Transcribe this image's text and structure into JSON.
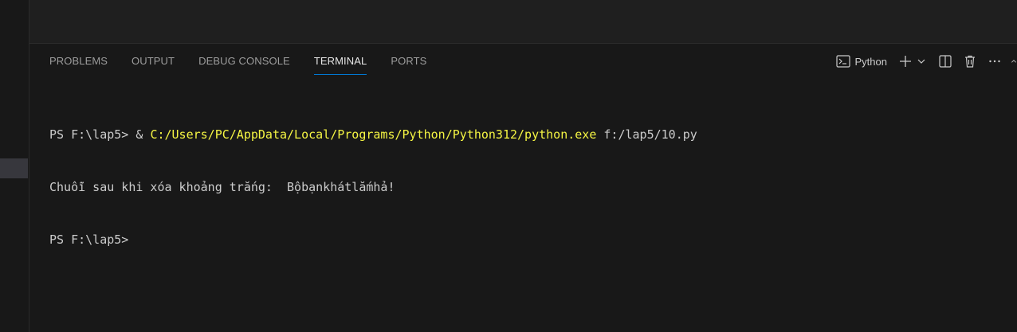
{
  "panel": {
    "tabs": [
      {
        "label": "PROBLEMS"
      },
      {
        "label": "OUTPUT"
      },
      {
        "label": "DEBUG CONSOLE"
      },
      {
        "label": "TERMINAL"
      },
      {
        "label": "PORTS"
      }
    ],
    "active_tab": "TERMINAL",
    "terminal_profile": "Python",
    "icons": [
      "terminal-icon",
      "plus-icon",
      "chevron-down-icon",
      "split-icon",
      "trash-icon",
      "more-icon",
      "chevron-up-icon"
    ]
  },
  "terminal": {
    "line1": {
      "prompt": "PS F:\\lap5> ",
      "operator": "& ",
      "exe": "C:/Users/PC/AppData/Local/Programs/Python/Python312/python.exe",
      "arg": " f:/lap5/10.py"
    },
    "line2": "Chuỗi sau khi xóa khoảng trắng:  Bộbạnkhátlắmhả!",
    "line3": "PS F:\\lap5> "
  },
  "colors": {
    "background": "#181818",
    "accent": "#0078d4",
    "path": "#f5f543"
  }
}
